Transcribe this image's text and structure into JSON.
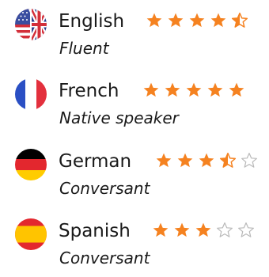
{
  "colors": {
    "star_fill": "#f58220",
    "star_empty_outline": "#b9b9b9",
    "text": "#1a1a1a"
  },
  "languages": [
    {
      "name": "English",
      "level": "Fluent",
      "flag": "us-uk-flag-icon",
      "rating": 4.5,
      "max_rating": 5
    },
    {
      "name": "French",
      "level": "Native speaker",
      "flag": "france-flag-icon",
      "rating": 5,
      "max_rating": 5
    },
    {
      "name": "German",
      "level": "Conversant",
      "flag": "germany-flag-icon",
      "rating": 3.5,
      "max_rating": 5
    },
    {
      "name": "Spanish",
      "level": "Conversant",
      "flag": "spain-flag-icon",
      "rating": 3,
      "max_rating": 5
    }
  ]
}
